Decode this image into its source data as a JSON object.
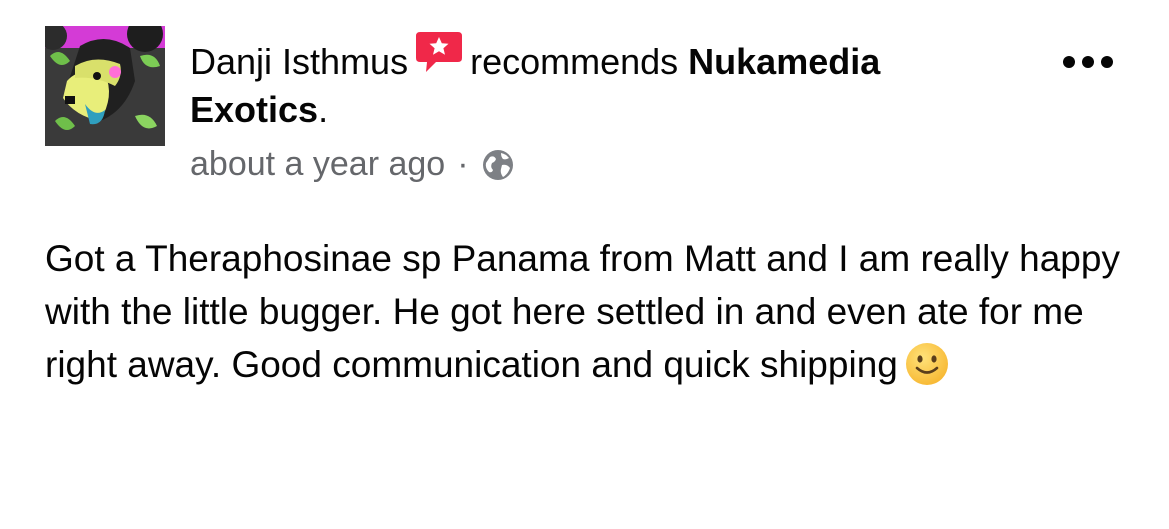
{
  "post": {
    "author": "Danji Isthmus",
    "action": "recommends",
    "page_name": "Nukamedia Exotics",
    "period": ".",
    "timestamp": "about a year ago",
    "separator": "·",
    "privacy_icon": "globe-icon",
    "recommend_icon": "recommend-star-bubble-icon",
    "more_icon": "more-horizontal-icon",
    "body": "Got a Theraphosinae sp Panama from Matt and I am really happy with the little bugger. He got here settled in and even ate for me right away. Good communication and quick shipping",
    "emoji": "slightly-smiling-face-icon"
  },
  "colors": {
    "text_primary": "#050505",
    "text_secondary": "#65676b",
    "recommend_red": "#f02849",
    "more_dots": "#050505"
  }
}
